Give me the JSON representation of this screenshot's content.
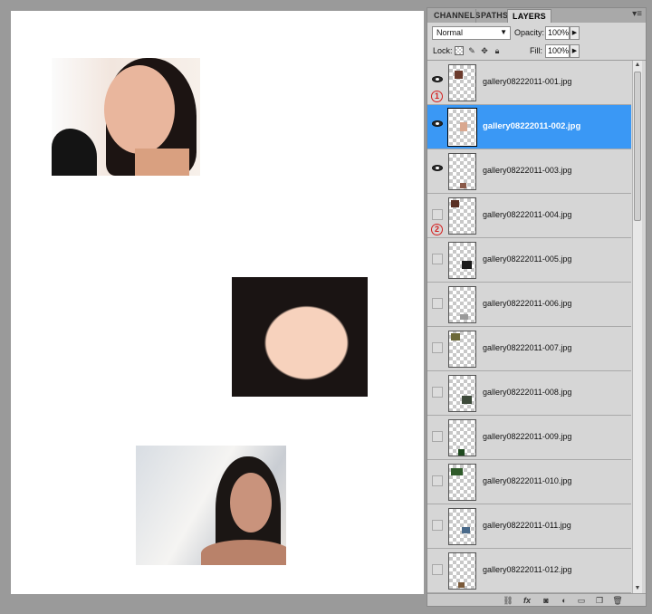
{
  "panel": {
    "tabs": [
      "CHANNELS",
      "PATHS",
      "LAYERS"
    ],
    "active_tab": "LAYERS",
    "menu_icon": "panel-menu-icon",
    "blend_mode": "Normal",
    "opacity_label": "Opacity:",
    "opacity_value": "100%",
    "lock_label": "Lock:",
    "fill_label": "Fill:",
    "fill_value": "100%"
  },
  "layers": [
    {
      "name": "gallery08222011-001.jpg",
      "visible": true,
      "selected": false,
      "marker": "1"
    },
    {
      "name": "gallery08222011-002.jpg",
      "visible": true,
      "selected": true,
      "marker": ""
    },
    {
      "name": "gallery08222011-003.jpg",
      "visible": true,
      "selected": false,
      "marker": ""
    },
    {
      "name": "gallery08222011-004.jpg",
      "visible": false,
      "selected": false,
      "marker": "2"
    },
    {
      "name": "gallery08222011-005.jpg",
      "visible": false,
      "selected": false,
      "marker": ""
    },
    {
      "name": "gallery08222011-006.jpg",
      "visible": false,
      "selected": false,
      "marker": ""
    },
    {
      "name": "gallery08222011-007.jpg",
      "visible": false,
      "selected": false,
      "marker": ""
    },
    {
      "name": "gallery08222011-008.jpg",
      "visible": false,
      "selected": false,
      "marker": ""
    },
    {
      "name": "gallery08222011-009.jpg",
      "visible": false,
      "selected": false,
      "marker": ""
    },
    {
      "name": "gallery08222011-010.jpg",
      "visible": false,
      "selected": false,
      "marker": ""
    },
    {
      "name": "gallery08222011-011.jpg",
      "visible": false,
      "selected": false,
      "marker": ""
    },
    {
      "name": "gallery08222011-012.jpg",
      "visible": false,
      "selected": false,
      "marker": ""
    }
  ],
  "bottom_icons": [
    "link-layers-icon",
    "fx-icon",
    "add-mask-icon",
    "adjustment-layer-icon",
    "new-group-icon",
    "new-layer-icon",
    "trash-icon"
  ],
  "bottom_fx_text": "fx"
}
